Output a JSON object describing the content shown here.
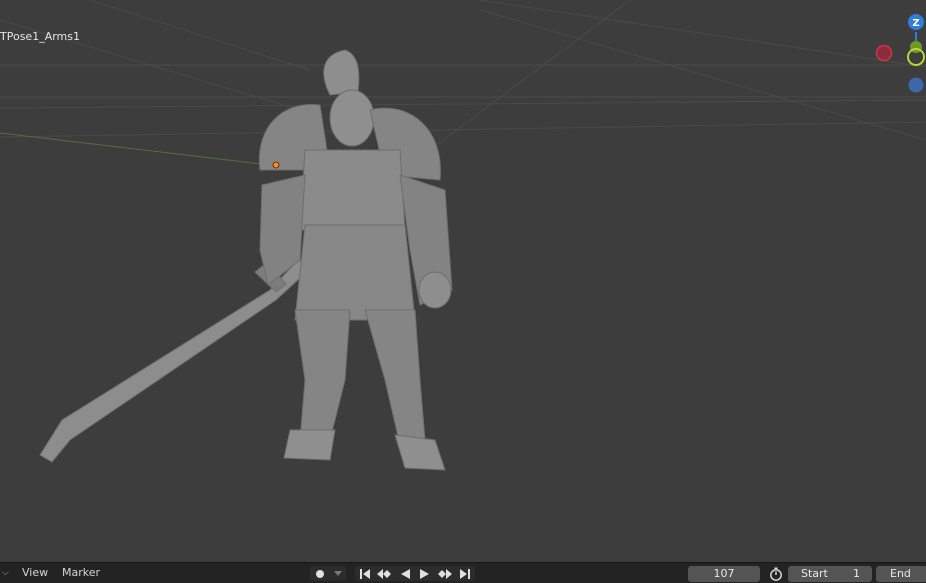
{
  "viewport": {
    "object_name": "TPose1_Arms1",
    "background_color": "#3d3d3d"
  },
  "gizmo": {
    "z_label": "Z",
    "z_color": "#2f7fd6",
    "x_color": "#c9364a",
    "y_color": "#8fbb24",
    "neg_axis_color": "#3d68a8"
  },
  "timeline": {
    "menu": {
      "view_label": "View",
      "marker_label": "Marker"
    },
    "playback": {
      "record_icon": "record-keyframe-icon",
      "jump_start_icon": "jump-to-start-icon",
      "prev_keyframe_icon": "previous-keyframe-icon",
      "play_reverse_icon": "play-reverse-icon",
      "play_icon": "play-icon",
      "next_keyframe_icon": "next-keyframe-icon",
      "jump_end_icon": "jump-to-end-icon"
    },
    "current_frame": "107",
    "start_label": "Start",
    "start_value": "1",
    "end_label": "End"
  }
}
